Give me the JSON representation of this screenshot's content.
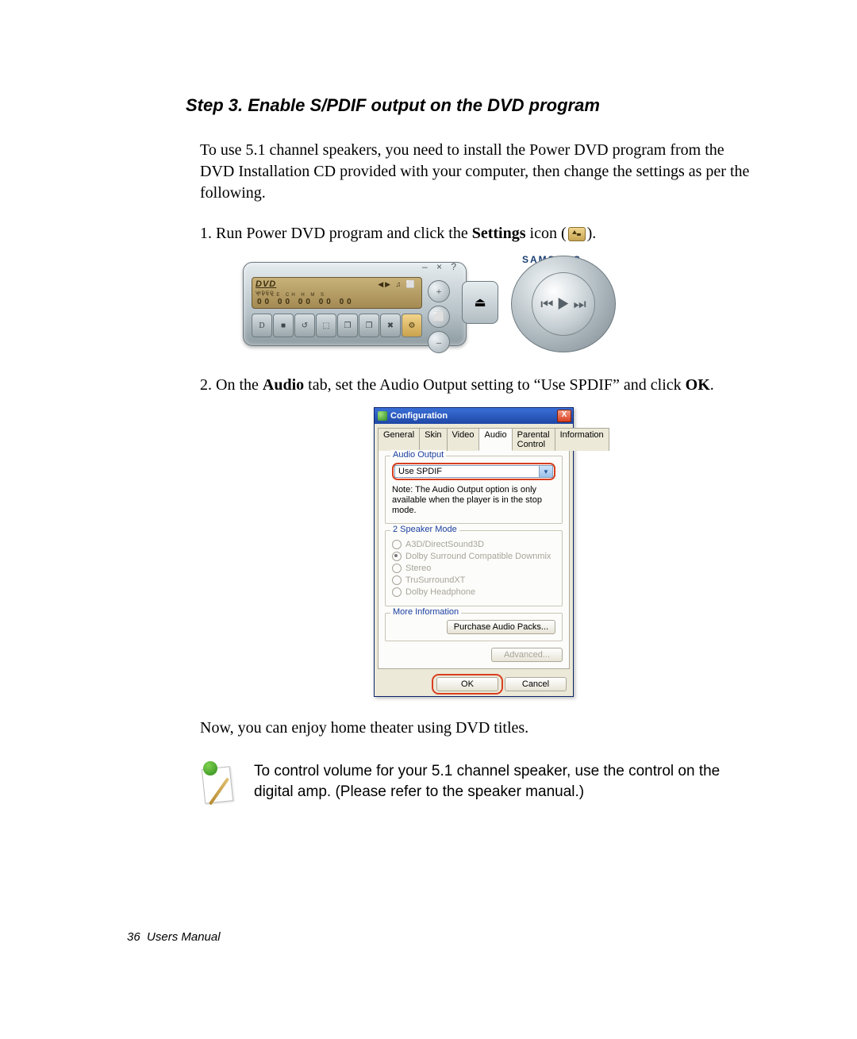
{
  "heading": "Step 3. Enable S/PDIF output on the DVD program",
  "intro": "To use 5.1 channel speakers, you need to install the Power DVD program from the DVD Installation CD provided with your computer, then change the settings as per the following.",
  "step1_prefix": "1. Run Power DVD program and click the ",
  "step1_bold": "Settings",
  "step1_suffix": " icon (",
  "step1_tail": ").",
  "step2_prefix": "2. On the ",
  "step2_bold1": "Audio",
  "step2_mid": " tab, set the Audio Output setting to “Use SPDIF” and click ",
  "step2_bold2": "OK",
  "step2_tail": ".",
  "conclusion": "Now, you can enjoy home theater using DVD titles.",
  "tip": "To control volume for your 5.1 channel speaker, use the control on the digital amp. (Please refer to the speaker manual.)",
  "footer_page": "36",
  "footer_label": "Users Manual",
  "player": {
    "brand": "SAMSUNG",
    "dvd_logo": "DVD",
    "dvd_sub": "VIDEO",
    "screen_icons": "◀▶  ♫  ⬜",
    "counter_labels": "TITLE  CH   H   M   S",
    "counter_values": "00   00  00  00  00",
    "window_ctrl": "– × ?",
    "toolbar": [
      "D",
      "■",
      "↺",
      "⬚",
      "❐",
      "❐",
      "✖",
      "⚙"
    ],
    "side": [
      "+",
      "⬜",
      "–"
    ],
    "eject": "⏏",
    "jog_glyphs": "⏮ ▶ ⏭"
  },
  "dialog": {
    "title": "Configuration",
    "tabs": [
      "General",
      "Skin",
      "Video",
      "Audio",
      "Parental Control",
      "Information"
    ],
    "active_tab_index": 3,
    "audio_output": {
      "label": "Audio Output",
      "selected": "Use SPDIF",
      "note": "Note:  The Audio Output option is only available when the player is in the stop mode."
    },
    "speaker_mode": {
      "label": "2 Speaker Mode",
      "options": [
        {
          "label": "A3D/DirectSound3D",
          "checked": false
        },
        {
          "label": "Dolby Surround Compatible Downmix",
          "checked": true
        },
        {
          "label": "Stereo",
          "checked": false
        },
        {
          "label": "TruSurroundXT",
          "checked": false
        },
        {
          "label": "Dolby Headphone",
          "checked": false
        }
      ]
    },
    "more_info": {
      "label": "More Information",
      "button": "Purchase Audio Packs..."
    },
    "advanced_btn": "Advanced...",
    "ok_btn": "OK",
    "cancel_btn": "Cancel"
  }
}
